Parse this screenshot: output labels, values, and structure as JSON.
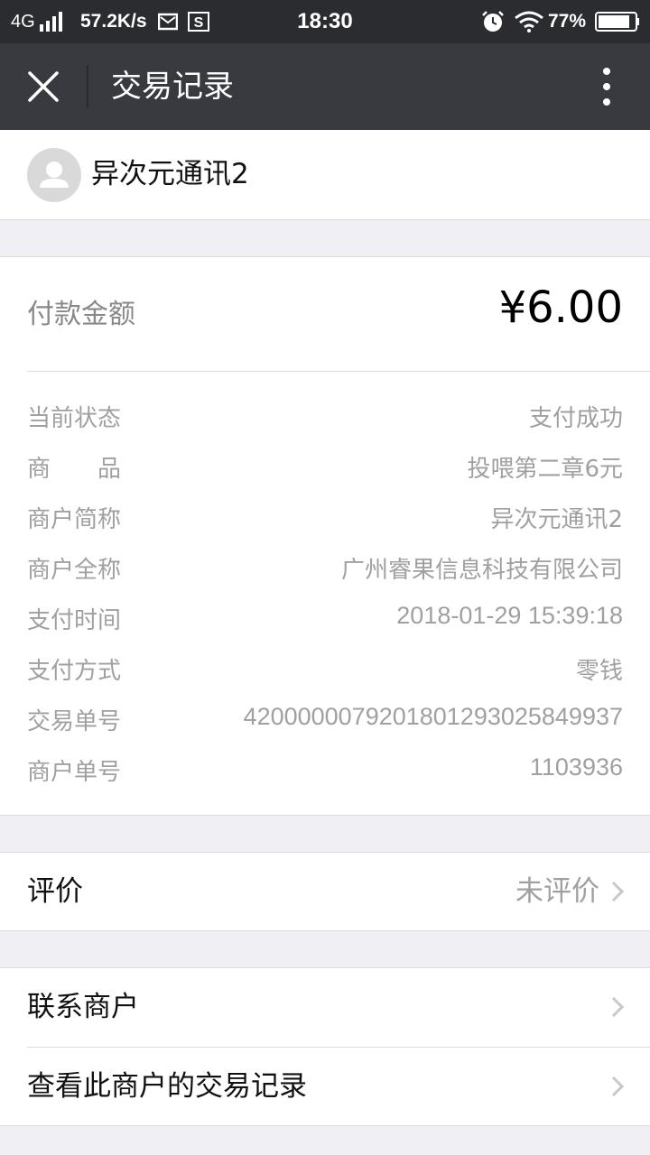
{
  "status_bar": {
    "network": "4G",
    "speed": "57.2K/s",
    "time": "18:30",
    "battery": "77%"
  },
  "header": {
    "title": "交易记录"
  },
  "merchant": {
    "name": "异次元通讯2"
  },
  "payment": {
    "amount_label": "付款金额",
    "amount": "¥6.00",
    "details": [
      {
        "key": "当前状态",
        "value": "支付成功"
      },
      {
        "key": "商　　品",
        "value": "投喂第二章6元"
      },
      {
        "key": "商户简称",
        "value": "异次元通讯2"
      },
      {
        "key": "商户全称",
        "value": "广州睿果信息科技有限公司"
      },
      {
        "key": "支付时间",
        "value": "2018-01-29 15:39:18"
      },
      {
        "key": "支付方式",
        "value": "零钱"
      },
      {
        "key": "交易单号",
        "value": "4200000079201801293025849937"
      },
      {
        "key": "商户单号",
        "value": "1103936"
      }
    ]
  },
  "review": {
    "label": "评价",
    "value": "未评价"
  },
  "links": {
    "contact": "联系商户",
    "history": "查看此商户的交易记录"
  },
  "colors": {
    "status_bar_bg": "#2b2c30",
    "title_bar_bg": "#393a3f",
    "page_bg": "#efeff4",
    "muted_text": "#a0a0a0"
  }
}
